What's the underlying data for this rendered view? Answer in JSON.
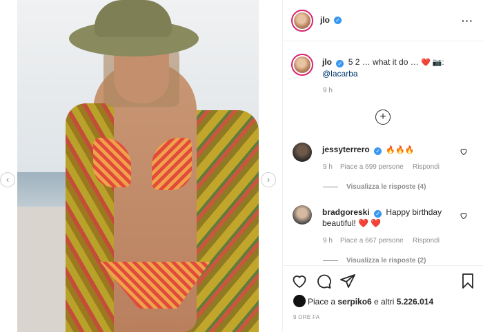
{
  "post": {
    "author": "jlo",
    "caption_prefix": "5 2 … what it do …",
    "caption_mention": "@lacarba",
    "caption_emojis": "❤️ 📷:",
    "time": "9 h",
    "load_more_icon": "plus-circle-icon",
    "more_icon": "more-options-icon"
  },
  "comments": [
    {
      "username": "jessyterrero",
      "text": "🔥🔥🔥",
      "time": "9 h",
      "likes": "Piace a 699 persone",
      "reply": "Rispondi",
      "view_replies": "Visualizza le risposte (4)"
    },
    {
      "username": "bradgoreski",
      "text": "Happy birthday beautiful! ❤️ ❤️",
      "time": "9 h",
      "likes": "Piace a 667 persone",
      "reply": "Rispondi",
      "view_replies": "Visualizza le risposte (2)"
    }
  ],
  "footer": {
    "likes_prefix": "Piace a ",
    "likes_user": "serpiko6",
    "likes_mid": " e altri ",
    "likes_count": "5.226.014",
    "time_ago": "9 ORE FA"
  },
  "colors": {
    "verified": "#3897f0",
    "heart": "#ed4956",
    "ring": "#d6246e"
  }
}
